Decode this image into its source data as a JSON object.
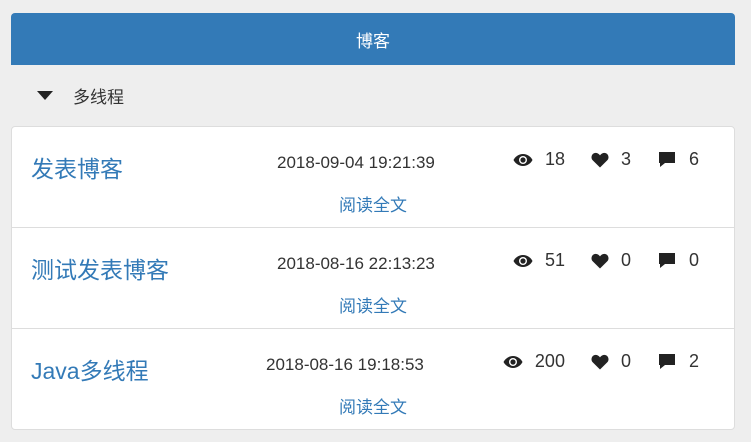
{
  "header": {
    "title": "博客"
  },
  "category": {
    "label": "多线程"
  },
  "posts": [
    {
      "title": "发表博客",
      "date": "2018-09-04 19:21:39",
      "views": "18",
      "likes": "3",
      "comments": "6",
      "read_more": "阅读全文"
    },
    {
      "title": "测试发表博客",
      "date": "2018-08-16 22:13:23",
      "views": "51",
      "likes": "0",
      "comments": "0",
      "read_more": "阅读全文"
    },
    {
      "title": "Java多线程",
      "date": "2018-08-16 19:18:53",
      "views": "200",
      "likes": "0",
      "comments": "2",
      "read_more": "阅读全文"
    }
  ],
  "icons": {
    "views": "eye-icon",
    "likes": "heart-icon",
    "comments": "comment-icon"
  },
  "colors": {
    "primary": "#337ab7",
    "background": "#eeeeee",
    "border": "#dddddd"
  }
}
